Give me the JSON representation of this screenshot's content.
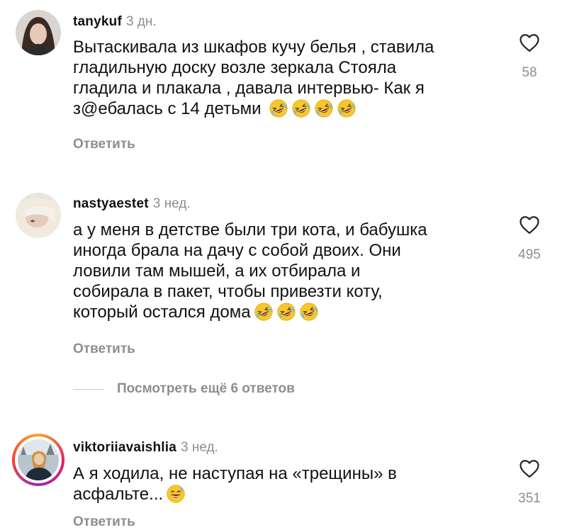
{
  "comments": [
    {
      "username": "tanykuf",
      "time": "3 дн.",
      "text_lines": [
        "Вытаскивала из шкафов кучу белья , ставила",
        "гладильную доску возле зеркала Стояла",
        "гладила и плакала , давала интервью- Как я",
        "з@ебалась с 14 детьми"
      ],
      "emoji_count": 4,
      "emoji": "rofl-emoji",
      "likes": "58",
      "reply_label": "Ответить"
    },
    {
      "username": "nastyaestet",
      "time": "3 нед.",
      "text_lines": [
        "а у меня в детстве были три кота, и бабушка",
        "иногда брала на дачу с собой двоих. Они",
        "ловили там мышей, а их отбирала и",
        "собирала в пакет, чтобы привезти коту,",
        "который остался дома"
      ],
      "emoji_count": 3,
      "emoji": "rofl-emoji",
      "likes": "495",
      "reply_label": "Ответить"
    },
    {
      "username": "viktoriiavaishlia",
      "time": "3 нед.",
      "text_lines": [
        "А я ходила, не наступая на «трещины» в",
        "асфальте..."
      ],
      "emoji_count": 1,
      "emoji": "sweat-smile-emoji",
      "likes": "351",
      "reply_label": "Ответить"
    }
  ],
  "view_more_replies": "Посмотреть ещё 6 ответов",
  "icons": {
    "like": "heart-outline-icon"
  },
  "colors": {
    "secondary_text": "#8e8e8e",
    "primary_text": "#111111",
    "emoji_yellow": "#f7c62f"
  }
}
